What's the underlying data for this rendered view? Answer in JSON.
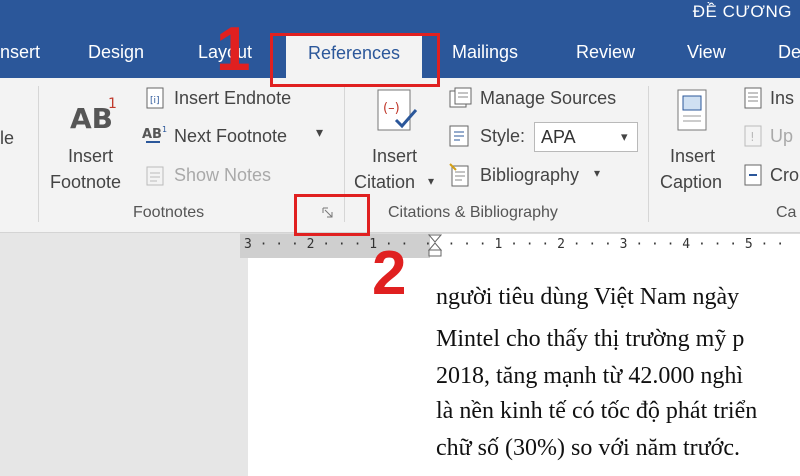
{
  "window": {
    "title": "ĐỀ CƯƠNG"
  },
  "tabs": [
    "nsert",
    "Design",
    "Layout",
    "References",
    "Mailings",
    "Review",
    "View",
    "De"
  ],
  "ribbon": {
    "footnotes": {
      "le_label": "le",
      "insert_footnote": [
        "Insert",
        "Footnote"
      ],
      "insert_endnote": "Insert Endnote",
      "next_footnote": "Next Footnote",
      "show_notes": "Show Notes",
      "group_label": "Footnotes"
    },
    "citations": {
      "insert_citation": [
        "Insert",
        "Citation"
      ],
      "manage_sources": "Manage Sources",
      "style_label": "Style:",
      "style_value": "APA",
      "bibliography": "Bibliography",
      "group_label": "Citations & Bibliography"
    },
    "captions": {
      "insert_caption": [
        "Insert",
        "Caption"
      ],
      "insert_table": "Ins",
      "update_table": "Up",
      "cross_reference": "Cro",
      "group_label": "Ca"
    }
  },
  "ruler": {
    "text": "3 · · · 2 · · · 1 · ·  ·  · · · 1 · · · 2 · · · 3 · · · 4 · · · 5 · ·"
  },
  "document": {
    "lines": [
      "người tiêu dùng Việt Nam ngày",
      "Mintel cho thấy thị trường mỹ p",
      "2018, tăng mạnh từ 42.000 nghì",
      "là nền kinh tế có tốc độ phát triển",
      "chữ số (30%) so với năm trước."
    ]
  },
  "annotations": {
    "step1": "1",
    "step2": "2"
  },
  "colors": {
    "accent": "#2b579a",
    "annotation": "#e02020"
  }
}
